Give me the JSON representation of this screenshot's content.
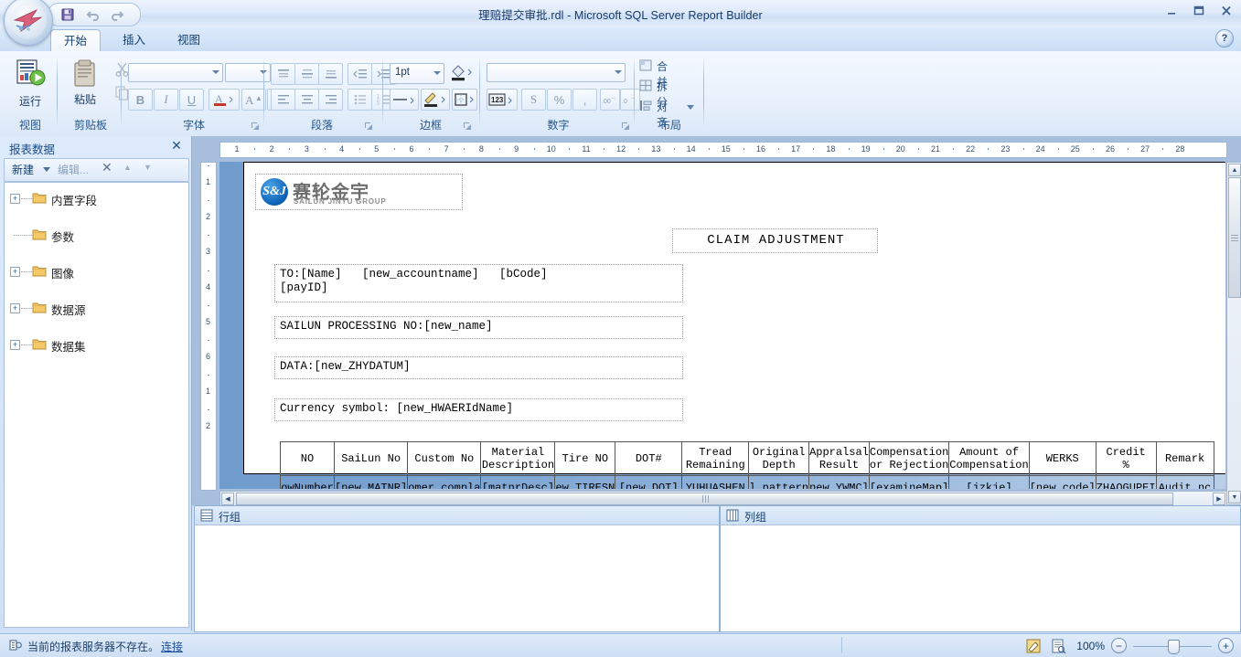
{
  "window": {
    "title": "理赔提交审批.rdl - Microsoft SQL Server Report Builder",
    "minimize": "–",
    "maximize": "❐",
    "close": "✕",
    "help": "?",
    "quick_access": [
      "save-icon",
      "undo-icon",
      "redo-icon"
    ]
  },
  "tabs": [
    {
      "label": "开始",
      "active": true
    },
    {
      "label": "插入",
      "active": false
    },
    {
      "label": "视图",
      "active": false
    }
  ],
  "ribbon": {
    "groups": [
      {
        "name": "视图",
        "label": "视图",
        "buttons": [
          {
            "label": "运行",
            "icon": "run-report-icon"
          }
        ]
      },
      {
        "name": "剪贴板",
        "label": "剪贴板",
        "buttons": [
          {
            "label": "粘贴",
            "icon": "paste-icon"
          }
        ],
        "small": [
          {
            "icon": "cut-icon"
          },
          {
            "icon": "copy-icon"
          }
        ]
      },
      {
        "name": "字体",
        "label": "字体",
        "font_name": "",
        "font_size": "",
        "buttons": [
          "B",
          "I",
          "U",
          "A",
          "A",
          "A"
        ]
      },
      {
        "name": "段落",
        "label": "段落",
        "buttons": [
          "align-top",
          "align-middle",
          "align-bottom",
          "indent-decrease",
          "indent-increase",
          "align-left",
          "align-center",
          "align-right",
          "bullet-list",
          "number-list"
        ]
      },
      {
        "name": "边框",
        "label": "边框",
        "width_value": "1pt",
        "buttons": [
          "fill-color-icon",
          "line-style-icon",
          "line-color-icon",
          "border-icon"
        ]
      },
      {
        "name": "数字",
        "label": "数字",
        "format_value": "",
        "buttons": [
          "123",
          "S",
          "%",
          ",",
          "increase-decimal",
          "decrease-decimal"
        ]
      },
      {
        "name": "布局",
        "label": "布局",
        "items": [
          {
            "label": "合并",
            "icon": "merge-cells-icon"
          },
          {
            "label": "拆分",
            "icon": "split-cells-icon"
          },
          {
            "label": "对齐",
            "icon": "align-shapes-icon",
            "has_menu": true
          }
        ]
      }
    ]
  },
  "report_data_pane": {
    "title": "报表数据",
    "close": "✕",
    "toolbar": {
      "new": "新建",
      "edit": "编辑...",
      "delete": "✕",
      "move_up": "▲",
      "move_down": "▼"
    },
    "tree": [
      {
        "label": "内置字段",
        "expandable": true
      },
      {
        "label": "参数",
        "expandable": false
      },
      {
        "label": "图像",
        "expandable": true
      },
      {
        "label": "数据源",
        "expandable": true
      },
      {
        "label": "数据集",
        "expandable": true
      }
    ]
  },
  "rulers": {
    "horizontal": [
      1,
      2,
      3,
      4,
      5,
      6,
      7,
      8,
      9,
      10,
      11,
      12,
      13,
      14,
      15,
      16,
      17,
      18,
      19,
      20,
      21,
      22,
      23,
      24,
      25,
      26,
      27,
      28
    ],
    "vertical": [
      1,
      2,
      3,
      4,
      5,
      6,
      1,
      2
    ]
  },
  "report": {
    "logo": {
      "mark": "S&J",
      "cn_name": "赛轮金宇",
      "en_name": "SAILUN JINYU GROUP"
    },
    "title_box": "CLAIM ADJUSTMENT",
    "boxes": [
      {
        "name": "to-box",
        "text": "TO:[Name]   [new_accountname]   [bCode]\n[payID]"
      },
      {
        "name": "processing-no-box",
        "text": "SAILUN PROCESSING NO:[new_name]"
      },
      {
        "name": "data-box",
        "text": "DATA:[new_ZHYDATUM]"
      },
      {
        "name": "currency-box",
        "text": "Currency symbol: [new_HWAERIdName]"
      }
    ],
    "table": {
      "headers": [
        "NO",
        "SaiLun No",
        "Custom No",
        "Material\nDescription",
        "Tire NO",
        "DOT#",
        "Tread\nRemaining",
        "Original\nDepth",
        "Appralsal\nResult",
        "Compensation\nor Rejection",
        "Amount of\nCompensation",
        "WERKS",
        "Credit\n%",
        "Remark"
      ],
      "row": [
        "owNumber",
        "[new_MATNR]",
        "omer_compla",
        "[matnrDesc]",
        "ew_TIRESN",
        "[new_DOT]",
        "YUHUASHEN",
        "l_pattern",
        "new_YWMC]",
        "[examineMap]",
        "[jzkje]",
        "[new_code]",
        "ZHAOGUPEI",
        "Audit_nc"
      ]
    }
  },
  "group_panes": [
    {
      "label": "行组",
      "icon": "row-group-icon"
    },
    {
      "label": "列组",
      "icon": "column-group-icon"
    }
  ],
  "status_bar": {
    "message": "当前的报表服务器不存在。",
    "link": "连接",
    "zoom_percent": "100%",
    "zoom_out": "−",
    "zoom_in": "+",
    "icons": [
      "edit-mode-icon",
      "preview-mode-icon"
    ]
  }
}
